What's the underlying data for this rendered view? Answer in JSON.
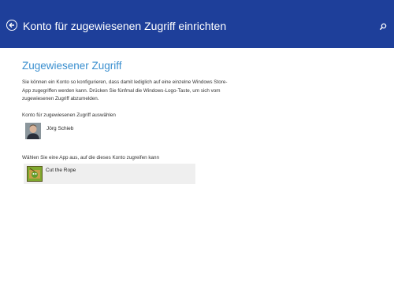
{
  "header": {
    "title": "Konto für zugewiesenen Zugriff einrichten",
    "back_icon": "back-arrow-icon",
    "search_icon": "search-icon",
    "background": "#1e3f9a"
  },
  "main": {
    "section_title": "Zugewiesener Zugriff",
    "description_lines": [
      "Sie können ein Konto so konfigurieren, dass damit lediglich auf eine einzelne Windows Store-",
      "App zugegriffen werden kann. Drücken Sie fünfmal die Windows-Logo-Taste, um sich vom",
      "zugewiesenen Zugriff abzumelden."
    ],
    "account_label": "Konto für zugewiesenen Zugriff auswählen",
    "account_name": "Jörg Schieb",
    "app_label": "Wählen Sie eine App aus, auf die dieses Konto zugreifen kann",
    "app_name": "Cut the Rope",
    "accent": "#3a8fcf"
  }
}
